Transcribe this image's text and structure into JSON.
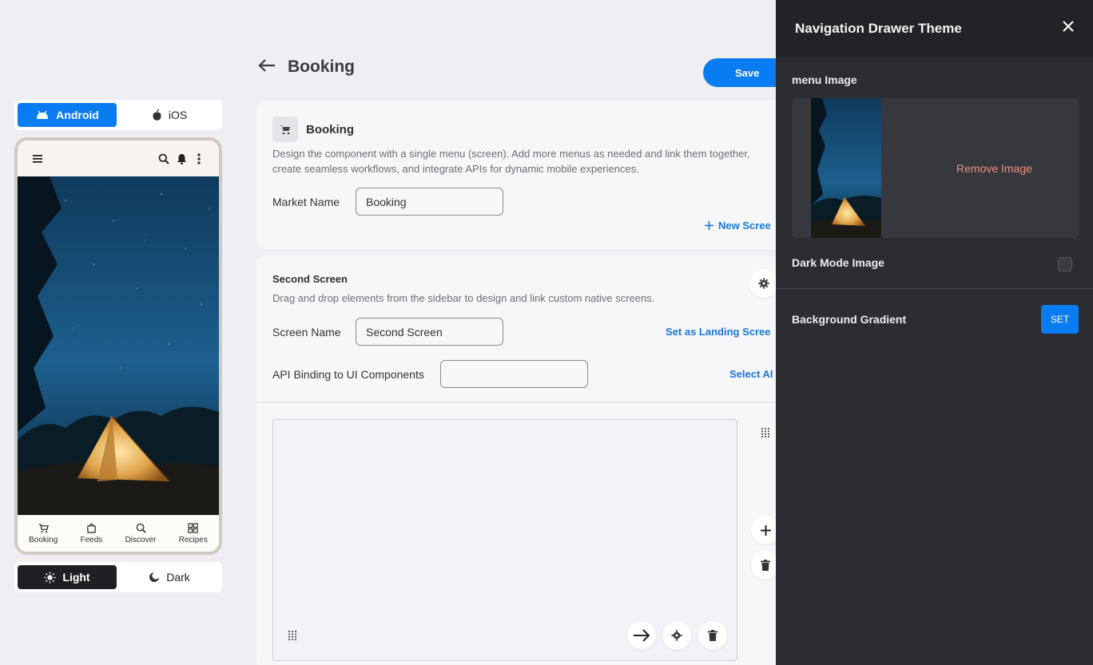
{
  "platform": {
    "android_label": "Android",
    "ios_label": "iOS"
  },
  "phone": {
    "tabs": [
      {
        "label": "Booking",
        "icon": "cart-icon"
      },
      {
        "label": "Feeds",
        "icon": "bag-icon"
      },
      {
        "label": "Discover",
        "icon": "search-zoom-icon"
      },
      {
        "label": "Recipes",
        "icon": "grid-icon"
      }
    ]
  },
  "theme": {
    "light_label": "Light",
    "dark_label": "Dark"
  },
  "header": {
    "title": "Booking",
    "save_label": "Save"
  },
  "menu_card": {
    "title": "Booking",
    "description_line1": "Design the component with a single menu (screen). Add more menus as needed and link them together,",
    "description_line2": "create seamless workflows, and integrate APIs for dynamic mobile experiences.",
    "market_name_label": "Market Name",
    "market_name_value": "Booking",
    "new_screen_label": "New Scree"
  },
  "screen_card": {
    "title": "Second Screen",
    "description": "Drag and drop elements from the sidebar to design and link custom native screens.",
    "screen_name_label": "Screen Name",
    "screen_name_value": "Second Screen",
    "set_landing_label": "Set as Landing Scree",
    "api_binding_label": "API Binding to UI Components",
    "api_binding_value": "",
    "select_api_label": "Select AI"
  },
  "drawer": {
    "title": "Navigation Drawer Theme",
    "menu_image_label": "menu Image",
    "remove_image_label": "Remove Image",
    "dark_mode_label": "Dark Mode Image",
    "dark_mode_checked": false,
    "bg_gradient_label": "Background Gradient",
    "set_label": "SET"
  },
  "colors": {
    "accent": "#0a7cf2",
    "drawer_bg": "#2c2d31",
    "remove_text": "#ef8e82",
    "link": "#1878d8"
  }
}
